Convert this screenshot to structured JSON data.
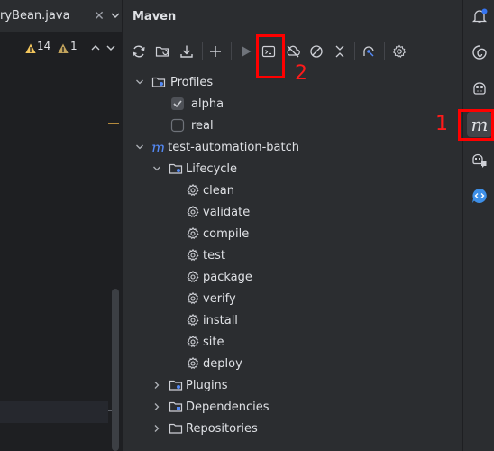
{
  "editor": {
    "tab_label": "ryBean.java",
    "tab_close": "✕",
    "warnings_count": "14",
    "weak_warnings_count": "1"
  },
  "maven": {
    "title": "Maven",
    "toolbar": {
      "reload": "reload-icon",
      "generate_sources": "generate-sources-icon",
      "download": "download-icon",
      "add": "add-icon",
      "run": "run-icon",
      "execute_goal": "execute-goal-icon",
      "toggle_offline": "offline-icon",
      "skip_tests": "skip-tests-icon",
      "collapse_all": "collapse-all-icon",
      "analyze_dependencies": "analyze-icon",
      "settings": "settings-icon"
    },
    "tree": {
      "profiles": {
        "label": "Profiles",
        "items": [
          {
            "label": "alpha",
            "checked": true
          },
          {
            "label": "real",
            "checked": false
          }
        ]
      },
      "project": {
        "label": "test-automation-batch",
        "lifecycle": {
          "label": "Lifecycle",
          "goals": [
            "clean",
            "validate",
            "compile",
            "test",
            "package",
            "verify",
            "install",
            "site",
            "deploy"
          ]
        },
        "plugins": "Plugins",
        "dependencies": "Dependencies",
        "repositories": "Repositories"
      }
    }
  },
  "annotations": {
    "marker_1": "1",
    "marker_2": "2",
    "color": "#ff0000"
  },
  "right_strip": {
    "icons": [
      "notifications-icon",
      "ai-assistant-icon",
      "copilot-icon",
      "maven-icon",
      "copilot-chat-icon",
      "code-review-icon"
    ],
    "active": "maven-icon",
    "notification_dot_color": "#3574f0"
  },
  "colors": {
    "panel_bg": "#2b2d30",
    "editor_bg": "#1e1f22",
    "text": "#dfe1e5",
    "accent_blue": "#548af7"
  }
}
